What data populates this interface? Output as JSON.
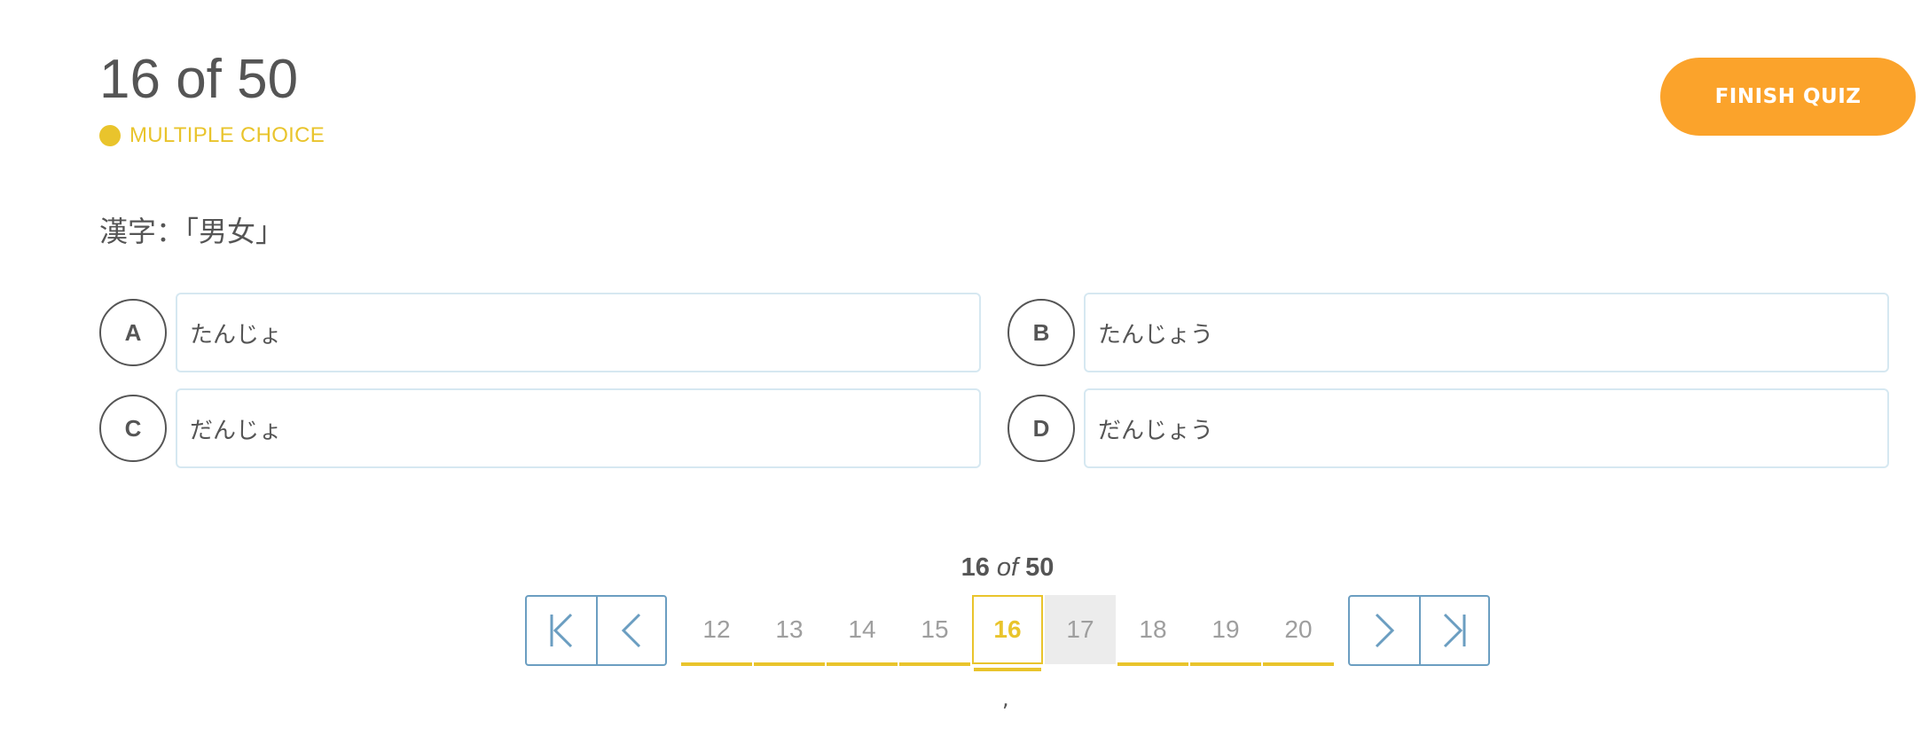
{
  "header": {
    "progress": "16 of 50",
    "question_type": "MULTIPLE CHOICE",
    "finish_label": "FINISH QUIZ"
  },
  "question": {
    "text": "漢字：「男女」"
  },
  "options": [
    {
      "letter": "A",
      "text": "たんじょ"
    },
    {
      "letter": "B",
      "text": "たんじょう"
    },
    {
      "letter": "C",
      "text": "だんじょ"
    },
    {
      "letter": "D",
      "text": "だんじょう"
    }
  ],
  "pager": {
    "current": "16",
    "of_word": "of",
    "total": "50",
    "pages": [
      "12",
      "13",
      "14",
      "15",
      "16",
      "17",
      "18",
      "19",
      "20"
    ],
    "stray_mark": ","
  },
  "colors": {
    "accent_yellow": "#e9c42c",
    "finish_orange": "#fba32b",
    "nav_blue": "#6b9ec1",
    "text_gray": "#555555"
  },
  "icons": {
    "first": "first-page-icon",
    "prev": "chevron-left-icon",
    "next": "chevron-right-icon",
    "last": "last-page-icon"
  }
}
